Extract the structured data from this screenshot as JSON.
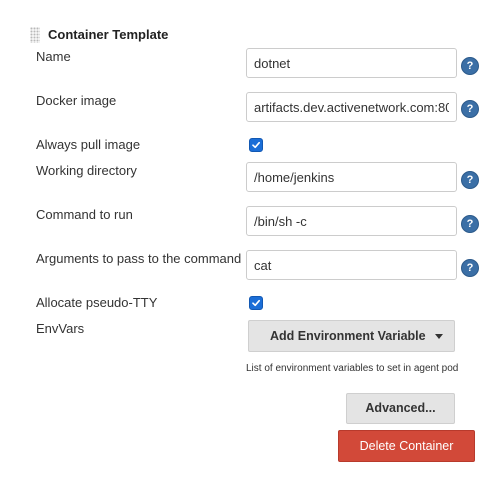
{
  "section": {
    "title": "Container Template"
  },
  "fields": {
    "name": {
      "label": "Name",
      "value": "dotnet"
    },
    "docker_image": {
      "label": "Docker image",
      "value": "artifacts.dev.activenetwork.com:80"
    },
    "always_pull": {
      "label": "Always pull image",
      "checked": true
    },
    "working_dir": {
      "label": "Working directory",
      "value": "/home/jenkins"
    },
    "command": {
      "label": "Command to run",
      "value": "/bin/sh -c"
    },
    "args": {
      "label": "Arguments to pass to the command",
      "value": "cat"
    },
    "tty": {
      "label": "Allocate pseudo-TTY",
      "checked": true
    },
    "env_vars": {
      "label": "EnvVars",
      "add_button": "Add Environment Variable",
      "description": "List of environment variables to set in agent pod"
    }
  },
  "help_glyph": "?",
  "buttons": {
    "advanced": "Advanced...",
    "delete": "Delete Container"
  },
  "colors": {
    "help_icon": "#3b6fa6",
    "checkbox": "#1b6ed7",
    "delete_button": "#d24939",
    "secondary_button": "#e4e4e4"
  },
  "icons": {
    "grip": "drag-handle-icon",
    "help": "help-icon",
    "dropdown": "caret-down-icon",
    "check": "check-icon"
  }
}
